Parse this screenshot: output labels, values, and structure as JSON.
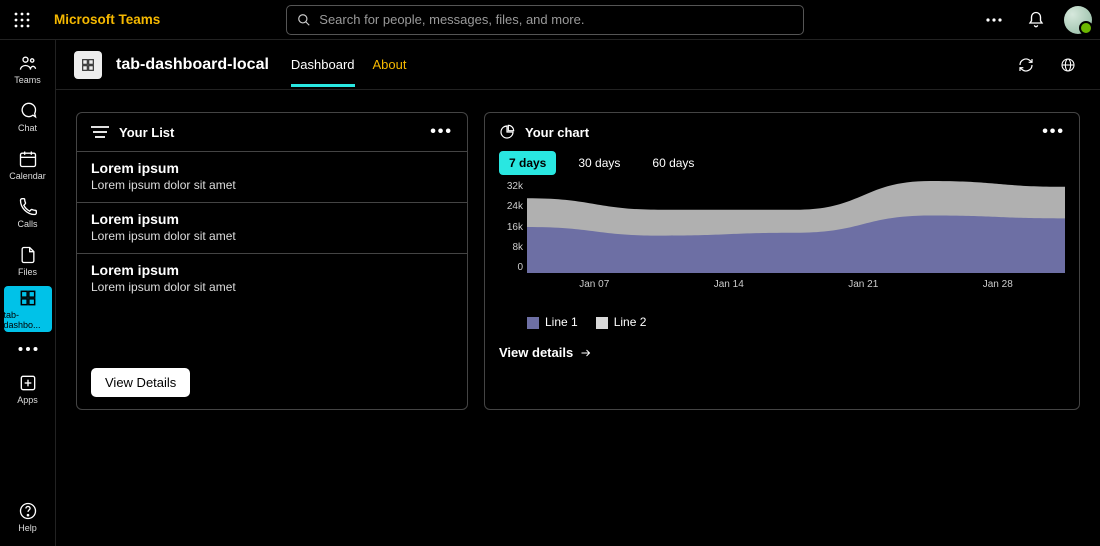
{
  "brand": "Microsoft Teams",
  "search": {
    "placeholder": "Search for people, messages, files, and more."
  },
  "rail": {
    "items": [
      {
        "label": "Teams"
      },
      {
        "label": "Chat"
      },
      {
        "label": "Calendar"
      },
      {
        "label": "Calls"
      },
      {
        "label": "Files"
      },
      {
        "label": "tab-dashbo..."
      }
    ],
    "apps": "Apps",
    "help": "Help"
  },
  "app": {
    "title": "tab-dashboard-local",
    "tabs": {
      "dashboard": "Dashboard",
      "about": "About"
    }
  },
  "list_card": {
    "title": "Your List",
    "items": [
      {
        "title": "Lorem ipsum",
        "sub": "Lorem ipsum dolor sit amet"
      },
      {
        "title": "Lorem ipsum",
        "sub": "Lorem ipsum dolor sit amet"
      },
      {
        "title": "Lorem ipsum",
        "sub": "Lorem ipsum dolor sit amet"
      }
    ],
    "cta": "View Details"
  },
  "chart_card": {
    "title": "Your chart",
    "ranges": [
      "7 days",
      "30 days",
      "60 days"
    ],
    "active_range": "7 days",
    "legend": [
      "Line 1",
      "Line 2"
    ],
    "view": "View details"
  },
  "chart_data": {
    "type": "area",
    "x": [
      "Jan 07",
      "Jan 14",
      "Jan 21",
      "Jan 28"
    ],
    "y_ticks": [
      "32k",
      "24k",
      "16k",
      "8k",
      "0"
    ],
    "ylim": [
      0,
      32
    ],
    "series": [
      {
        "name": "Line 1",
        "color": "#6d6fa4",
        "values": [
          16,
          13,
          14,
          20,
          19
        ]
      },
      {
        "name": "Line 2",
        "color": "#b0b0b0",
        "values": [
          26,
          22,
          22,
          32,
          30
        ]
      }
    ],
    "title": "Your chart"
  }
}
